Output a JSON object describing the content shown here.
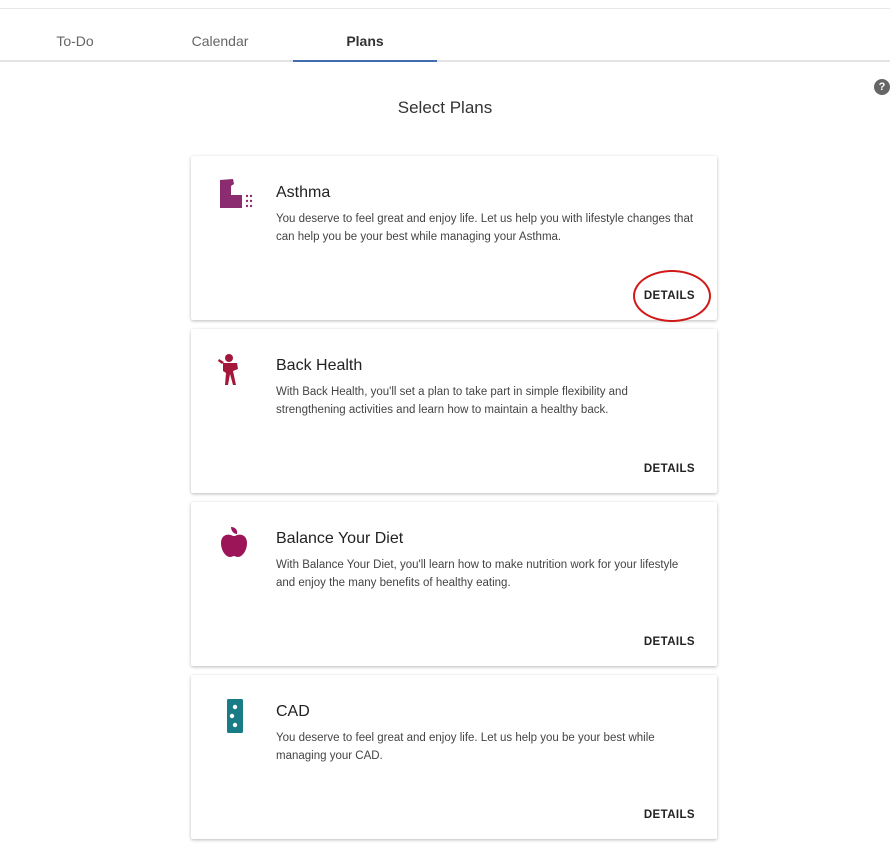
{
  "tabs": [
    {
      "label": "To-Do"
    },
    {
      "label": "Calendar"
    },
    {
      "label": "Plans"
    }
  ],
  "help_icon": "help-icon",
  "page": {
    "title": "Select Plans"
  },
  "plans": [
    {
      "title": "Asthma",
      "icon": "inhaler-icon",
      "description": "You deserve to feel great and enjoy life. Let us help you with lifestyle changes that can help you be your best while managing your Asthma.",
      "action": "DETAILS"
    },
    {
      "title": "Back Health",
      "icon": "stretching-person-icon",
      "description": "With Back Health, you'll set a plan to take part in simple flexibility and strengthening activities and learn how to maintain a healthy back.",
      "action": "DETAILS"
    },
    {
      "title": "Balance Your Diet",
      "icon": "apple-icon",
      "description": "With Balance Your Diet, you'll learn how to make nutrition work for your lifestyle and enjoy the many benefits of healthy eating.",
      "action": "DETAILS"
    },
    {
      "title": "CAD",
      "icon": "heart-monitor-icon",
      "description": "You deserve to feel great and enjoy life. Let us help you be your best while managing your CAD.",
      "action": "DETAILS"
    }
  ],
  "colors": {
    "asthma": "#8a2c6f",
    "back_health": "#a3173a",
    "diet": "#9c1558",
    "cad": "#187b86",
    "active_tab_underline": "#3f6fb0",
    "annotation": "#d01a1a"
  }
}
